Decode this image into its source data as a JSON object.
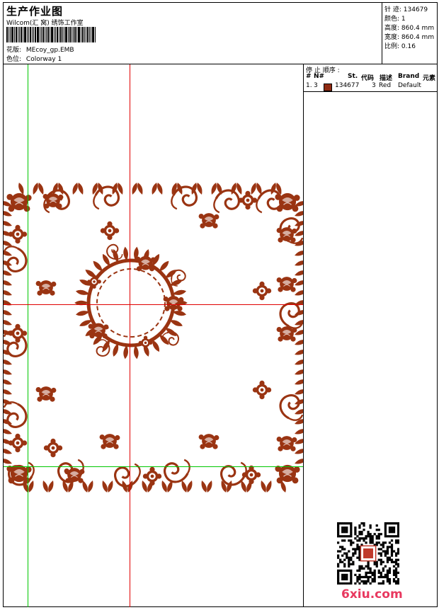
{
  "header": {
    "title": "生产作业图",
    "subtitle": "Wilcom(汇 窝) 绣饰工作室",
    "design_label": "花版:",
    "design_value": "MEcoy_gp.EMB",
    "colorway_label": "色位:",
    "colorway_value": "Colorway 1"
  },
  "stats": [
    {
      "label": "针 迹:",
      "value": "134679"
    },
    {
      "label": "颜色:",
      "value": "1"
    },
    {
      "label": "高度:",
      "value": "860.4 mm"
    },
    {
      "label": "宽度:",
      "value": "860.4 mm"
    },
    {
      "label": "比例:",
      "value": "0.16"
    }
  ],
  "stop_panel": {
    "title": "停 止 顺序 :",
    "columns": [
      "#",
      "N#",
      "St.",
      "代码",
      "描述",
      "Brand",
      "元素"
    ],
    "rows": [
      {
        "index": "1.",
        "n": "3",
        "swatch_color": "#8f2a12",
        "stitches": "134677",
        "code": "3",
        "desc": "Red",
        "brand": "Default",
        "element": ""
      }
    ]
  },
  "colors": {
    "thread": "#9a3412",
    "guide_green": "#00c800",
    "guide_red": "#e00000"
  },
  "watermark": "6xiu.com",
  "qr_icon": "qr-code-icon"
}
